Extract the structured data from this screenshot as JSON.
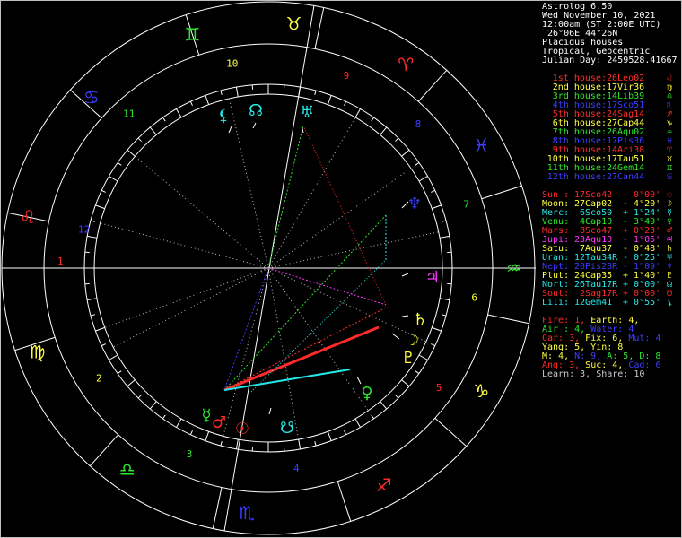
{
  "header": {
    "app_title": "Astrolog 6.50",
    "date": "Wed November 10, 2021",
    "time": "12:00am (ST 2:00E UTC)",
    "location": " 26°06E 44°26N",
    "house_system": "Placidus houses",
    "zodiac": "Tropical, Geocentric",
    "julian_day": "Julian Day: 2459528.41667"
  },
  "colors": {
    "white": "#ffffff",
    "red": "#ff2a2a",
    "green": "#2ce62c",
    "blue": "#3d3dff",
    "yellow": "#ffff40",
    "cyan": "#25e8e8",
    "magenta": "#ff33ff",
    "orange": "#ff8c1a",
    "grey": "#c8c8c8"
  },
  "houses": [
    {
      "label": "1st house:",
      "value": "26Leo02",
      "glyph": "♌",
      "color": "#ff2a2a"
    },
    {
      "label": "2nd house:",
      "value": "17Vir36",
      "glyph": "♍",
      "color": "#ffff40"
    },
    {
      "label": "3rd house:",
      "value": "14Lib39",
      "glyph": "♎",
      "color": "#2ce62c"
    },
    {
      "label": "4th house:",
      "value": "17Sco51",
      "glyph": "♏",
      "color": "#3d3dff"
    },
    {
      "label": "5th house:",
      "value": "24Sag14",
      "glyph": "♐",
      "color": "#ff2a2a"
    },
    {
      "label": "6th house:",
      "value": "27Cap44",
      "glyph": "♑",
      "color": "#ffff40"
    },
    {
      "label": "7th house:",
      "value": "26Aqu02",
      "glyph": "♒",
      "color": "#2ce62c"
    },
    {
      "label": "8th house:",
      "value": "17Pis36",
      "glyph": "♓",
      "color": "#3d3dff"
    },
    {
      "label": "9th house:",
      "value": "14Ari38",
      "glyph": "♈",
      "color": "#ff2a2a"
    },
    {
      "label": "10th house:",
      "value": "17Tau51",
      "glyph": "♉",
      "color": "#ffff40"
    },
    {
      "label": "11th house:",
      "value": "24Gem14",
      "glyph": "♊",
      "color": "#2ce62c"
    },
    {
      "label": "12th house:",
      "value": "27Can44",
      "glyph": "♋",
      "color": "#3d3dff"
    }
  ],
  "planets": [
    {
      "name": "Sun :",
      "pos": "17Sco42",
      "lat": " - 0°00'",
      "glyph": "☉",
      "color": "#ff2a2a"
    },
    {
      "name": "Moon:",
      "pos": "27Cap02",
      "lat": " - 4°20'",
      "glyph": "☽",
      "color": "#ffff40"
    },
    {
      "name": "Merc:",
      "pos": " 6Sco50",
      "lat": " + 1°24'",
      "glyph": "☿",
      "color": "#25e8e8"
    },
    {
      "name": "Venu:",
      "pos": " 4Cap10",
      "lat": " - 3°49'",
      "glyph": "♀",
      "color": "#2ce62c"
    },
    {
      "name": "Mars:",
      "pos": " 8Sco47",
      "lat": " + 0°23'",
      "glyph": "♂",
      "color": "#ff2a2a"
    },
    {
      "name": "Jupi:",
      "pos": "23Aqu10",
      "lat": " - 1°05'",
      "glyph": "♃",
      "color": "#ff33ff"
    },
    {
      "name": "Satu:",
      "pos": " 7Aqu37",
      "lat": " - 0°48'",
      "glyph": "♄",
      "color": "#ffff40"
    },
    {
      "name": "Uran:",
      "pos": "12Tau34R",
      "lat": " - 0°25'",
      "glyph": "♅",
      "color": "#25e8e8"
    },
    {
      "name": "Nept:",
      "pos": "20Pis28R",
      "lat": " - 1°09'",
      "glyph": "♆",
      "color": "#3d3dff"
    },
    {
      "name": "Plut:",
      "pos": "24Cap35",
      "lat": " + 1°40'",
      "glyph": "♇",
      "color": "#ffff40"
    },
    {
      "name": "Nort:",
      "pos": "26Tau17R",
      "lat": " + 0°00'",
      "glyph": "☊",
      "color": "#25e8e8"
    },
    {
      "name": "Sout:",
      "pos": " 2Sag17R",
      "lat": " + 0°00'",
      "glyph": "☋",
      "color": "#ff2a2a"
    },
    {
      "name": "Lili:",
      "pos": "12Gem41",
      "lat": " + 0°55'",
      "glyph": "⚸",
      "color": "#25e8e8"
    }
  ],
  "stats": {
    "fire_earth": [
      {
        "t": "Fire: 1, ",
        "c": "#ff2a2a"
      },
      {
        "t": "Earth: 4,",
        "c": "#ffff40"
      }
    ],
    "air_water": [
      {
        "t": "Air : 4, ",
        "c": "#2ce62c"
      },
      {
        "t": "Water: 4",
        "c": "#3d3dff"
      }
    ],
    "modes": [
      {
        "t": "Car: 3, ",
        "c": "#ff2a2a"
      },
      {
        "t": "Fix: 6, ",
        "c": "#ffff40"
      },
      {
        "t": "Mut: 4",
        "c": "#3d3dff"
      }
    ],
    "yang_yin": [
      {
        "t": "Yang: 5, Yin: 8",
        "c": "#ffff40"
      }
    ],
    "mnsa": [
      {
        "t": "M: 4, ",
        "c": "#ffff40"
      },
      {
        "t": "N: 9, ",
        "c": "#3d3dff"
      },
      {
        "t": "A: 5, ",
        "c": "#2ce62c"
      },
      {
        "t": "D: 8",
        "c": "#2ce62c"
      }
    ],
    "ang_suc": [
      {
        "t": "Ang: 3, ",
        "c": "#ff2a2a"
      },
      {
        "t": "Suc: 4, ",
        "c": "#ffff40"
      },
      {
        "t": "Cad: 6",
        "c": "#3d3dff"
      }
    ],
    "learn": [
      {
        "t": "Learn: 3, Share: 10",
        "c": "#c8c8c8"
      }
    ]
  },
  "wheel": {
    "sign_glyphs": [
      {
        "glyph": "♉",
        "color": "#ffff40"
      },
      {
        "glyph": "♈",
        "color": "#ff2a2a"
      },
      {
        "glyph": "♓",
        "color": "#3d3dff"
      },
      {
        "glyph": "♒",
        "color": "#2ce62c"
      },
      {
        "glyph": "♑",
        "color": "#ffff40"
      },
      {
        "glyph": "♐",
        "color": "#ff2a2a"
      },
      {
        "glyph": "♏",
        "color": "#3d3dff"
      },
      {
        "glyph": "♎",
        "color": "#2ce62c"
      },
      {
        "glyph": "♍",
        "color": "#ffff40"
      },
      {
        "glyph": "♌",
        "color": "#ff2a2a"
      },
      {
        "glyph": "♋",
        "color": "#3d3dff"
      },
      {
        "glyph": "♊",
        "color": "#2ce62c"
      }
    ],
    "house_numbers": [
      {
        "n": "10",
        "color": "#ffff40"
      },
      {
        "n": "9",
        "color": "#ff2a2a"
      },
      {
        "n": "8",
        "color": "#3d3dff"
      },
      {
        "n": "7",
        "color": "#2ce62c"
      },
      {
        "n": "6",
        "color": "#ffff40"
      },
      {
        "n": "5",
        "color": "#ff2a2a"
      },
      {
        "n": "4",
        "color": "#3d3dff"
      },
      {
        "n": "3",
        "color": "#2ce62c"
      },
      {
        "n": "2",
        "color": "#ffff40"
      },
      {
        "n": "1",
        "color": "#ff2a2a"
      },
      {
        "n": "12",
        "color": "#3d3dff"
      },
      {
        "n": "11",
        "color": "#2ce62c"
      }
    ],
    "planet_glyphs": [
      {
        "glyph": "⚸",
        "color": "#25e8e8"
      },
      {
        "glyph": "☊",
        "color": "#25e8e8"
      },
      {
        "glyph": "♅",
        "color": "#25e8e8"
      },
      {
        "glyph": "♆",
        "color": "#3d3dff"
      },
      {
        "glyph": "♃",
        "color": "#ff33ff"
      },
      {
        "glyph": "♄",
        "color": "#ffff40"
      },
      {
        "glyph": "☽",
        "color": "#ffff40"
      },
      {
        "glyph": "♇",
        "color": "#ffff40"
      },
      {
        "glyph": "♀",
        "color": "#2ce62c"
      },
      {
        "glyph": "☋",
        "color": "#25e8e8"
      },
      {
        "glyph": "☉",
        "color": "#ff2a2a"
      },
      {
        "glyph": "♂",
        "color": "#ff2a2a"
      },
      {
        "glyph": "☿",
        "color": "#2ce62c"
      }
    ]
  }
}
